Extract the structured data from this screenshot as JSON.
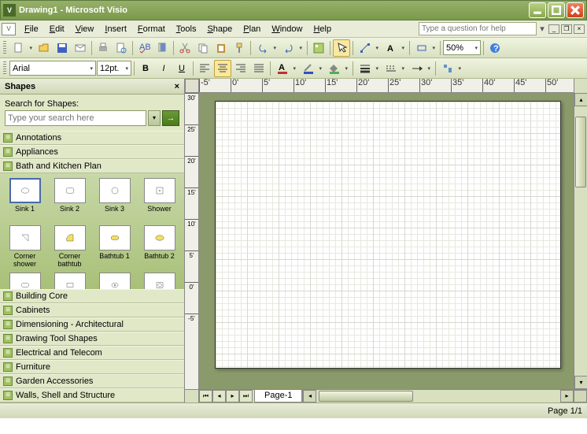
{
  "window": {
    "title": "Drawing1 - Microsoft Visio"
  },
  "menu": {
    "items": [
      "File",
      "Edit",
      "View",
      "Insert",
      "Format",
      "Tools",
      "Shape",
      "Plan",
      "Window",
      "Help"
    ],
    "help_placeholder": "Type a question for help"
  },
  "toolbar2": {
    "zoom": "50%"
  },
  "toolbar3": {
    "font": "Arial",
    "size": "12pt."
  },
  "shapes": {
    "title": "Shapes",
    "search_label": "Search for Shapes:",
    "search_placeholder": "Type your search here",
    "categories_top": [
      "Annotations",
      "Appliances",
      "Bath and Kitchen Plan"
    ],
    "stencil": [
      "Sink 1",
      "Sink 2",
      "Sink 3",
      "Shower",
      "Corner shower",
      "Corner bathtub",
      "Bathtub 1",
      "Bathtub 2",
      "",
      "",
      "",
      ""
    ],
    "categories_bottom": [
      "Building Core",
      "Cabinets",
      "Dimensioning - Architectural",
      "Drawing Tool Shapes",
      "Electrical and Telecom",
      "Furniture",
      "Garden Accessories",
      "Walls, Shell and Structure"
    ]
  },
  "ruler_h": [
    "-5'",
    "0'",
    "5'",
    "10'",
    "15'",
    "20'",
    "25'",
    "30'",
    "35'",
    "40'",
    "45'",
    "50'"
  ],
  "ruler_v": [
    "30'",
    "25'",
    "20'",
    "15'",
    "10'",
    "5'",
    "0'",
    "-5'"
  ],
  "tabs": {
    "page1": "Page-1"
  },
  "status": {
    "page": "Page 1/1"
  }
}
